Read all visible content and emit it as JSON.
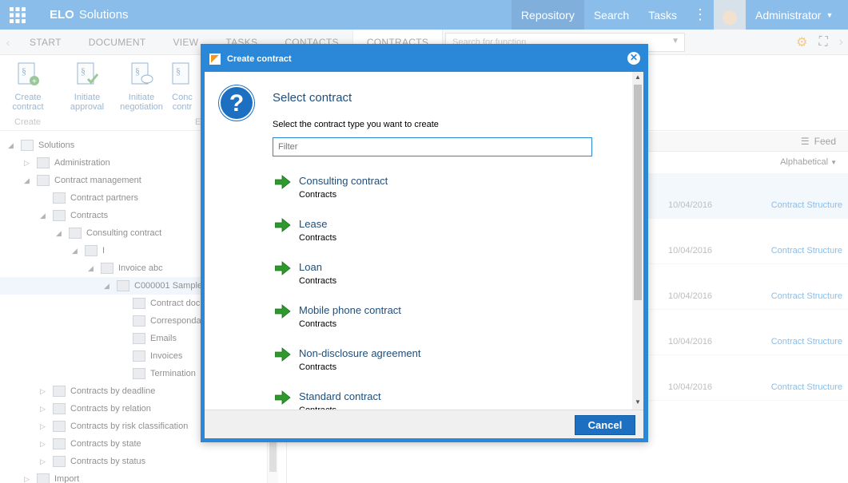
{
  "header": {
    "brand_bold": "ELO",
    "brand_text": "Solutions",
    "nav": [
      "Repository",
      "Search",
      "Tasks"
    ],
    "active_nav": "Repository",
    "user": "Administrator"
  },
  "ribbon_tabs": [
    "START",
    "DOCUMENT",
    "VIEW",
    "TASKS",
    "CONTACTS",
    "CONTRACTS"
  ],
  "active_ribbon_tab": "CONTRACTS",
  "function_search": {
    "placeholder": "Search for function"
  },
  "ribbon": {
    "buttons": [
      {
        "line1": "Create",
        "line2": "contract",
        "icon": "create-contract-icon"
      },
      {
        "line1": "Initiate",
        "line2": "approval",
        "icon": "approval-icon"
      },
      {
        "line1": "Initiate",
        "line2": "negotiation",
        "icon": "negotiation-icon"
      },
      {
        "line1": "Conc",
        "line2": "contr",
        "icon": "conclude-contract-icon"
      }
    ],
    "groups": [
      "Create",
      "E"
    ]
  },
  "tree": [
    {
      "label": "Solutions",
      "level": 0,
      "toggle": "expanded"
    },
    {
      "label": "Administration",
      "level": 1,
      "toggle": "collapsed"
    },
    {
      "label": "Contract management",
      "level": 1,
      "toggle": "expanded"
    },
    {
      "label": "Contract partners",
      "level": 2,
      "toggle": "none"
    },
    {
      "label": "Contracts",
      "level": 2,
      "toggle": "expanded"
    },
    {
      "label": "Consulting contract",
      "level": 3,
      "toggle": "expanded"
    },
    {
      "label": "I",
      "level": 4,
      "toggle": "expanded"
    },
    {
      "label": "Invoice abc",
      "level": 5,
      "toggle": "expanded"
    },
    {
      "label": "C000001 Sample",
      "level": 6,
      "toggle": "expanded",
      "selected": true
    },
    {
      "label": "Contract docu",
      "level": 7,
      "toggle": "none"
    },
    {
      "label": "Correspondar",
      "level": 7,
      "toggle": "none"
    },
    {
      "label": "Emails",
      "level": 7,
      "toggle": "none"
    },
    {
      "label": "Invoices",
      "level": 7,
      "toggle": "none"
    },
    {
      "label": "Termination",
      "level": 7,
      "toggle": "none"
    },
    {
      "label": "Contracts by deadline",
      "level": 2,
      "toggle": "collapsed"
    },
    {
      "label": "Contracts by relation",
      "level": 2,
      "toggle": "collapsed"
    },
    {
      "label": "Contracts by risk classification",
      "level": 2,
      "toggle": "collapsed"
    },
    {
      "label": "Contracts by state",
      "level": 2,
      "toggle": "collapsed"
    },
    {
      "label": "Contracts by status",
      "level": 2,
      "toggle": "collapsed"
    },
    {
      "label": "Import",
      "level": 1,
      "toggle": "collapsed"
    }
  ],
  "list": {
    "feed_label": "Feed",
    "sort": "Alphabetical",
    "rows": [
      {
        "date": "10/04/2016",
        "link": "Contract Structure"
      },
      {
        "date": "10/04/2016",
        "link": "Contract Structure"
      },
      {
        "date": "10/04/2016",
        "link": "Contract Structure"
      },
      {
        "date": "10/04/2016",
        "link": "Contract Structure"
      },
      {
        "date": "10/04/2016",
        "link": "Contract Structure"
      }
    ]
  },
  "dialog": {
    "title": "Create contract",
    "heading": "Select contract",
    "subtitle": "Select the contract type you want to create",
    "filter_placeholder": "Filter",
    "options": [
      {
        "name": "Consulting contract",
        "category": "Contracts"
      },
      {
        "name": "Lease",
        "category": "Contracts"
      },
      {
        "name": "Loan",
        "category": "Contracts"
      },
      {
        "name": "Mobile phone contract",
        "category": "Contracts"
      },
      {
        "name": "Non-disclosure agreement",
        "category": "Contracts"
      },
      {
        "name": "Standard contract",
        "category": "Contracts"
      }
    ],
    "cancel_label": "Cancel"
  },
  "colors": {
    "accent": "#2b88d8",
    "button": "#1d6fc2",
    "arrow_green": "#2e9a2e"
  }
}
